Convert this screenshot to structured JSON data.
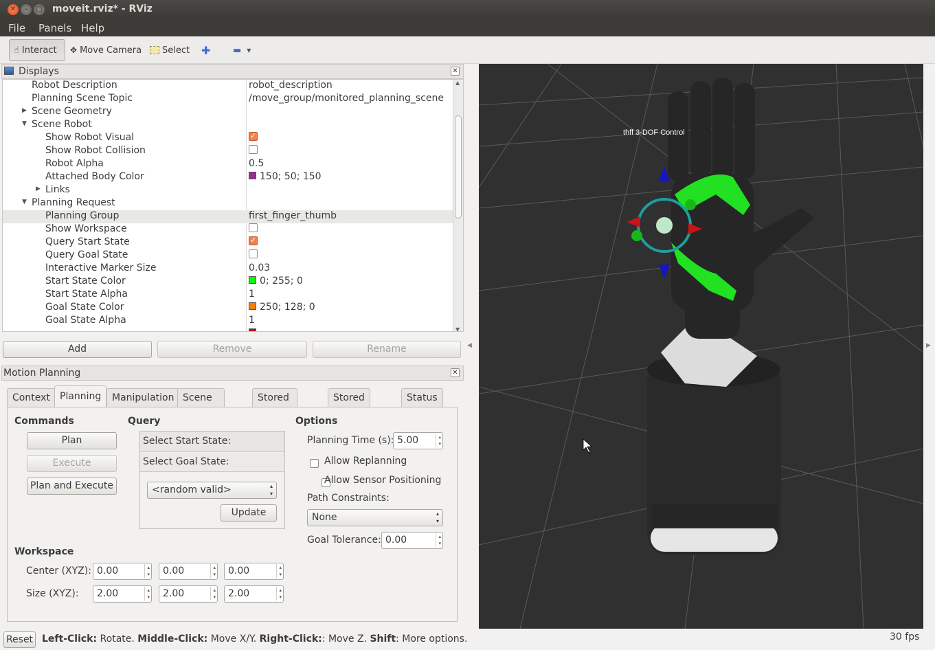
{
  "window": {
    "title": "moveit.rviz* - RViz"
  },
  "menu": [
    "File",
    "Panels",
    "Help"
  ],
  "toolbar": {
    "interact": "Interact",
    "move_camera": "Move Camera",
    "select": "Select"
  },
  "displays": {
    "title": "Displays",
    "rows": [
      {
        "k": "Robot Description",
        "v": "robot_description"
      },
      {
        "k": "Planning Scene Topic",
        "v": "/move_group/monitored_planning_scene"
      },
      {
        "k": "Scene Geometry",
        "v": ""
      },
      {
        "k": "Scene Robot",
        "v": ""
      },
      {
        "k": "Show Robot Visual",
        "v": ""
      },
      {
        "k": "Show Robot Collision",
        "v": ""
      },
      {
        "k": "Robot Alpha",
        "v": "0.5"
      },
      {
        "k": "Attached Body Color",
        "v": "150; 50; 150"
      },
      {
        "k": "Links",
        "v": ""
      },
      {
        "k": "Planning Request",
        "v": ""
      },
      {
        "k": "Planning Group",
        "v": "first_finger_thumb"
      },
      {
        "k": "Show Workspace",
        "v": ""
      },
      {
        "k": "Query Start State",
        "v": ""
      },
      {
        "k": "Query Goal State",
        "v": ""
      },
      {
        "k": "Interactive Marker Size",
        "v": "0.03"
      },
      {
        "k": "Start State Color",
        "v": "0; 255; 0"
      },
      {
        "k": "Start State Alpha",
        "v": "1"
      },
      {
        "k": "Goal State Color",
        "v": "250; 128; 0"
      },
      {
        "k": "Goal State Alpha",
        "v": "1"
      }
    ],
    "colors": {
      "attached": "#962d96",
      "start": "#00ff00",
      "goal": "#fa8000"
    },
    "buttons": {
      "add": "Add",
      "remove": "Remove",
      "rename": "Rename"
    }
  },
  "motion": {
    "title": "Motion Planning",
    "tabs": [
      "Context",
      "Planning",
      "Manipulation",
      "Scene Objects",
      "Stored Scenes",
      "Stored States",
      "Status"
    ],
    "commands": {
      "title": "Commands",
      "plan": "Plan",
      "execute": "Execute",
      "plan_execute": "Plan and Execute"
    },
    "query": {
      "title": "Query",
      "start": "Select Start State:",
      "goal": "Select Goal State:",
      "combo": "<random valid>",
      "update": "Update"
    },
    "options": {
      "title": "Options",
      "planning_time_label": "Planning Time (s):",
      "planning_time": "5.00",
      "replanning": "Allow Replanning",
      "sensor": "Allow Sensor Positioning",
      "path_label": "Path Constraints:",
      "path": "None",
      "goal_tol_label": "Goal Tolerance:",
      "goal_tol": "0.00"
    },
    "workspace": {
      "title": "Workspace",
      "center_label": "Center (XYZ):",
      "center": [
        "0.00",
        "0.00",
        "0.00"
      ],
      "size_label": "Size (XYZ):",
      "size": [
        "2.00",
        "2.00",
        "2.00"
      ]
    }
  },
  "viewport": {
    "marker_label": "thff  3-DOF  Control"
  },
  "status": {
    "reset": "Reset",
    "lc": "Left-Click:",
    "lc_t": " Rotate. ",
    "mc": "Middle-Click:",
    "mc_t": " Move X/Y. ",
    "rc": "Right-Click:",
    "rc_t": ": Move Z. ",
    "sh": "Shift",
    "sh_t": ": More options.",
    "fps": "30 fps"
  }
}
